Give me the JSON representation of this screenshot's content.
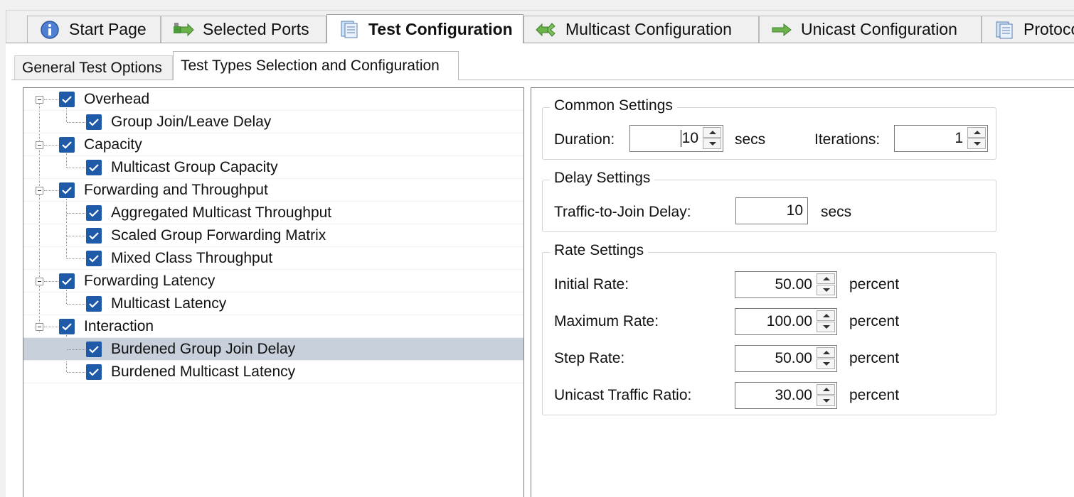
{
  "tabs": [
    {
      "label": "Start Page",
      "icon": "info-icon"
    },
    {
      "label": "Selected Ports",
      "icon": "ports-icon"
    },
    {
      "label": "Test Configuration",
      "icon": "document-icon",
      "active": true
    },
    {
      "label": "Multicast Configuration",
      "icon": "multicast-icon"
    },
    {
      "label": "Unicast Configuration",
      "icon": "arrow-right-icon"
    },
    {
      "label": "Protocol",
      "icon": "document-icon"
    }
  ],
  "subtabs": [
    {
      "label": "General Test Options"
    },
    {
      "label": "Test Types Selection and Configuration",
      "active": true
    }
  ],
  "tree": [
    {
      "label": "Overhead",
      "level": 0,
      "checked": true
    },
    {
      "label": "Group Join/Leave Delay",
      "level": 1,
      "checked": true
    },
    {
      "label": "Capacity",
      "level": 0,
      "checked": true
    },
    {
      "label": "Multicast Group Capacity",
      "level": 1,
      "checked": true
    },
    {
      "label": "Forwarding and Throughput",
      "level": 0,
      "checked": true
    },
    {
      "label": "Aggregated Multicast Throughput",
      "level": 1,
      "checked": true
    },
    {
      "label": "Scaled Group Forwarding Matrix",
      "level": 1,
      "checked": true
    },
    {
      "label": "Mixed Class Throughput",
      "level": 1,
      "checked": true
    },
    {
      "label": "Forwarding Latency",
      "level": 0,
      "checked": true
    },
    {
      "label": "Multicast Latency",
      "level": 1,
      "checked": true
    },
    {
      "label": "Interaction",
      "level": 0,
      "checked": true
    },
    {
      "label": "Burdened Group Join Delay",
      "level": 1,
      "checked": true,
      "selected": true
    },
    {
      "label": "Burdened Multicast Latency",
      "level": 1,
      "checked": true
    }
  ],
  "common": {
    "title": "Common Settings",
    "duration_label": "Duration:",
    "duration_value": "10",
    "duration_unit": "secs",
    "iterations_label": "Iterations:",
    "iterations_value": "1"
  },
  "delay": {
    "title": "Delay Settings",
    "traffic_label": "Traffic-to-Join Delay:",
    "traffic_value": "10",
    "traffic_unit": "secs"
  },
  "rate": {
    "title": "Rate Settings",
    "initial_label": "Initial Rate:",
    "initial_value": "50.00",
    "maximum_label": "Maximum Rate:",
    "maximum_value": "100.00",
    "step_label": "Step Rate:",
    "step_value": "50.00",
    "unicast_label": "Unicast Traffic Ratio:",
    "unicast_value": "30.00",
    "unit": "percent"
  },
  "colors": {
    "checkbox": "#1e5aa8",
    "selection": "#c8d0dc"
  }
}
